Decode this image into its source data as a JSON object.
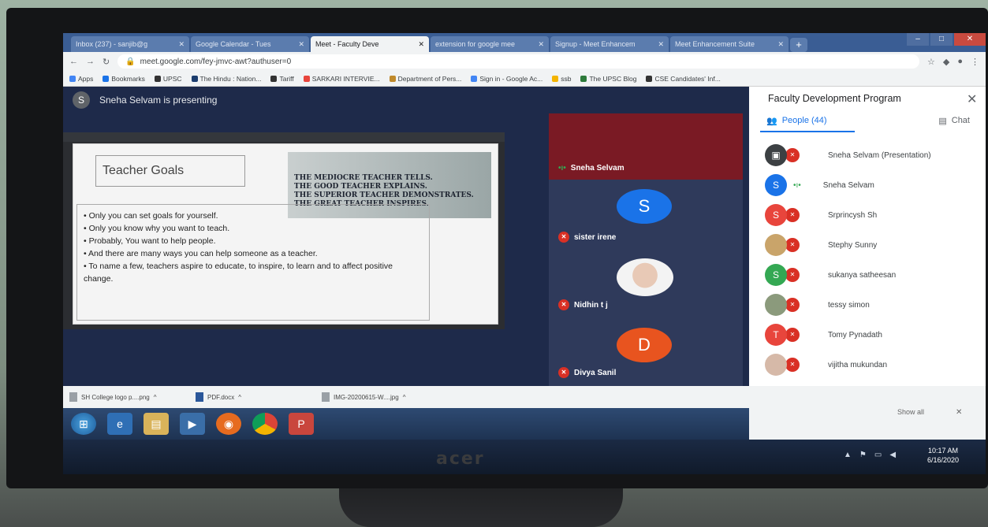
{
  "browser": {
    "tabs": [
      {
        "label": "Inbox (237) - sanjib@g",
        "active": false
      },
      {
        "label": "Google Calendar - Tues",
        "active": false
      },
      {
        "label": "Meet - Faculty Deve",
        "active": true
      },
      {
        "label": "extension for google mee",
        "active": false
      },
      {
        "label": "Signup - Meet Enhancem",
        "active": false
      },
      {
        "label": "Meet Enhancement Suite",
        "active": false
      }
    ],
    "url": "meet.google.com/fey-jmvc-awt?authuser=0",
    "bookmarks": [
      "Apps",
      "Bookmarks",
      "UPSC",
      "The Hindu : Nation...",
      "Tariff",
      "SARKARI INTERVIE...",
      "Department of Pers...",
      "Sign in - Google Ac...",
      "ssb",
      "The UPSC Blog",
      "CSE Candidates' Inf..."
    ]
  },
  "meet": {
    "presenting_avatar": "S",
    "presenting_text": "Sneha Selvam is presenting",
    "slide": {
      "title": "Teacher Goals",
      "quote_lines": [
        "THE MEDIOCRE TEACHER TELLS.",
        "THE GOOD TEACHER EXPLAINS.",
        "THE SUPERIOR TEACHER DEMONSTRATES.",
        "THE GREAT TEACHER INSPIRES."
      ],
      "bullets": [
        "• Only you can set goals for yourself.",
        "• Only you know why you want to teach.",
        "• Probably, You want to help people.",
        "• And there are many ways you can help someone as a teacher.",
        "• To name a few, teachers aspire to educate, to inspire, to learn and to affect positive change."
      ]
    },
    "tiles": [
      {
        "name": "Sneha Selvam",
        "avatar": ""
      },
      {
        "name": "sister irene",
        "avatar": "S"
      },
      {
        "name": "Nidhin t j",
        "avatar": ""
      },
      {
        "name": "Divya Sanil",
        "avatar": "D"
      }
    ]
  },
  "sidebar": {
    "title": "Faculty Development Program",
    "people_tab": "People (44)",
    "chat_tab": "Chat",
    "participants": [
      {
        "name": "Sneha Selvam (Presentation)",
        "avatar": "",
        "color": "#3c4043"
      },
      {
        "name": "Sneha Selvam",
        "avatar": "S",
        "color": "#1a73e8"
      },
      {
        "name": "Srprincysh Sh",
        "avatar": "S",
        "color": "#e8453c"
      },
      {
        "name": "Stephy Sunny",
        "avatar": "",
        "color": "#c9a46a"
      },
      {
        "name": "sukanya satheesan",
        "avatar": "S",
        "color": "#34a853"
      },
      {
        "name": "tessy simon",
        "avatar": "",
        "color": "#8b9a7c"
      },
      {
        "name": "Tomy Pynadath",
        "avatar": "T",
        "color": "#e8453c"
      },
      {
        "name": "vijitha mukundan",
        "avatar": "",
        "color": "#d6b9a8"
      }
    ]
  },
  "downloads": {
    "items": [
      "SH College logo p....png",
      "PDF.docx",
      "IMG-20200615-W....jpg"
    ],
    "show_all": "Show all"
  },
  "tray": {
    "time": "10:17 AM",
    "date": "6/16/2020"
  },
  "monitor_brand": "acer"
}
